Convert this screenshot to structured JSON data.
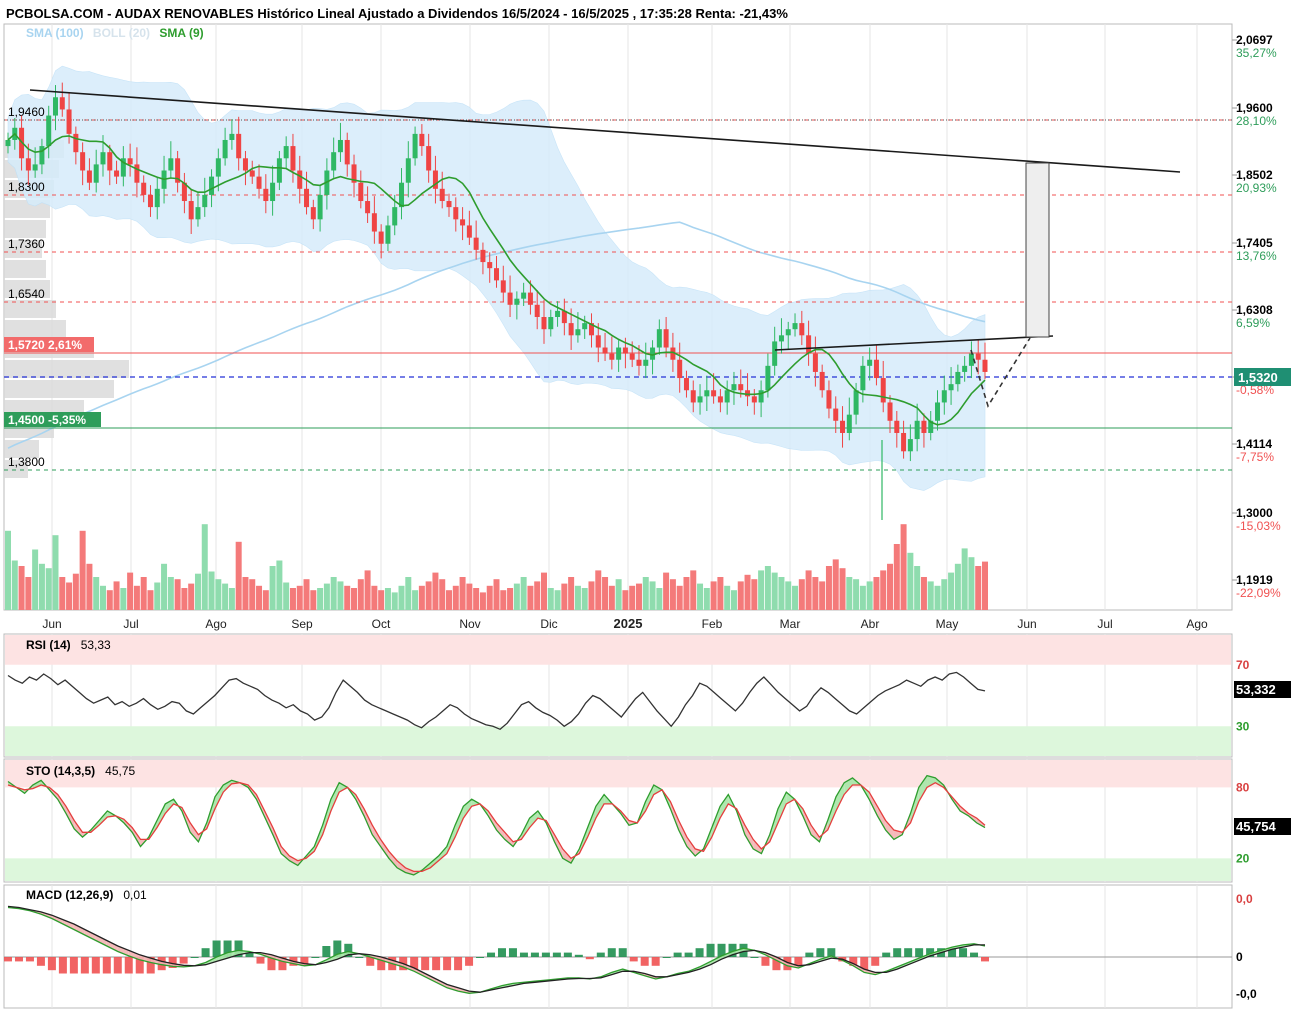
{
  "header": {
    "title": "PCBOLSA.COM - AUDAX RENOVABLES Histórico Lineal Ajustado a Dividendos 16/5/2024 - 16/5/2025 , 17:35:28 Renta: -21,43%"
  },
  "legend": {
    "sma100": {
      "label": "SMA (100)",
      "color": "#a8d4f0"
    },
    "boll": {
      "label": "BOLL (20)",
      "color": "#cfe3f3"
    },
    "sma9": {
      "label": "SMA (9)",
      "color": "#2e9d2e"
    }
  },
  "colors": {
    "up": "#4fc17b",
    "down": "#f05252",
    "sma9": "#2e9d2e",
    "sma100": "#a8d4f0",
    "boll_fill": "#d6ecfb",
    "trend": "#1a1a1a",
    "red_line": "#f05252",
    "green_line": "#2e9d5a",
    "blue_dash": "#2431d6"
  },
  "chart_data": [
    {
      "type": "candlestick",
      "name": "price",
      "x_labels": [
        "Jun",
        "Jul",
        "Ago",
        "Sep",
        "Oct",
        "Nov",
        "Dic",
        "2025",
        "Feb",
        "Mar",
        "Abr",
        "May",
        "Jun",
        "Jul",
        "Ago"
      ],
      "y_ticks_right": [
        {
          "value": "2,0697",
          "pct": "35,27%",
          "pct_color": "#2e9d5a"
        },
        {
          "value": "1,9600",
          "pct": "28,10%",
          "pct_color": "#2e9d5a"
        },
        {
          "value": "1,8502",
          "pct": "20,93%",
          "pct_color": "#2e9d5a"
        },
        {
          "value": "1,7405",
          "pct": "13,76%",
          "pct_color": "#2e9d5a"
        },
        {
          "value": "1,6308",
          "pct": "6,59%",
          "pct_color": "#2e9d5a"
        },
        {
          "value": "1,5320",
          "pct": "-0,58%",
          "pct_color": "#f05252"
        },
        {
          "value": "1,4114",
          "pct": "-7,75%",
          "pct_color": "#f05252"
        },
        {
          "value": "1,3000",
          "pct": "-15,03%",
          "pct_color": "#f05252"
        },
        {
          "value": "1,1919",
          "pct": "-22,09%",
          "pct_color": "#f05252"
        }
      ],
      "left_levels": [
        {
          "value": "1,9460",
          "kind": "red-dash"
        },
        {
          "value": "1,8300",
          "kind": "red-dash"
        },
        {
          "value": "1,7360",
          "kind": "red-dash"
        },
        {
          "value": "1,6540",
          "kind": "red-dash"
        },
        {
          "value": "1,5720 2,61%",
          "kind": "red-solid"
        },
        {
          "value": "1,4500 -5,35%",
          "kind": "green-solid"
        },
        {
          "value": "1,3800",
          "kind": "green-dash"
        }
      ],
      "last_price": "1,5320",
      "ylim": [
        1.14,
        2.1
      ],
      "closes": [
        1.91,
        1.93,
        1.88,
        1.86,
        1.87,
        1.9,
        1.95,
        1.98,
        1.96,
        1.92,
        1.89,
        1.86,
        1.84,
        1.87,
        1.89,
        1.86,
        1.85,
        1.88,
        1.87,
        1.84,
        1.82,
        1.8,
        1.83,
        1.86,
        1.88,
        1.84,
        1.81,
        1.78,
        1.8,
        1.82,
        1.85,
        1.88,
        1.91,
        1.92,
        1.88,
        1.86,
        1.85,
        1.83,
        1.81,
        1.84,
        1.88,
        1.9,
        1.86,
        1.83,
        1.8,
        1.78,
        1.82,
        1.86,
        1.89,
        1.91,
        1.87,
        1.84,
        1.81,
        1.79,
        1.76,
        1.74,
        1.77,
        1.8,
        1.84,
        1.88,
        1.92,
        1.9,
        1.86,
        1.83,
        1.81,
        1.8,
        1.78,
        1.77,
        1.75,
        1.73,
        1.71,
        1.7,
        1.68,
        1.66,
        1.64,
        1.65,
        1.66,
        1.64,
        1.62,
        1.6,
        1.62,
        1.63,
        1.61,
        1.59,
        1.6,
        1.61,
        1.59,
        1.57,
        1.56,
        1.55,
        1.57,
        1.56,
        1.55,
        1.54,
        1.55,
        1.57,
        1.6,
        1.57,
        1.55,
        1.52,
        1.5,
        1.48,
        1.49,
        1.5,
        1.49,
        1.48,
        1.5,
        1.51,
        1.5,
        1.49,
        1.48,
        1.5,
        1.54,
        1.58,
        1.59,
        1.6,
        1.61,
        1.59,
        1.56,
        1.53,
        1.5,
        1.47,
        1.45,
        1.43,
        1.46,
        1.5,
        1.54,
        1.55,
        1.52,
        1.48,
        1.45,
        1.43,
        1.4,
        1.42,
        1.45,
        1.43,
        1.45,
        1.48,
        1.5,
        1.51,
        1.53,
        1.54,
        1.56,
        1.55,
        1.53
      ],
      "volumes": [
        0.72,
        0.45,
        0.4,
        0.3,
        0.55,
        0.42,
        0.38,
        0.68,
        0.3,
        0.25,
        0.33,
        0.72,
        0.42,
        0.3,
        0.22,
        0.18,
        0.26,
        0.2,
        0.34,
        0.22,
        0.3,
        0.18,
        0.25,
        0.42,
        0.3,
        0.28,
        0.2,
        0.24,
        0.33,
        0.78,
        0.35,
        0.28,
        0.24,
        0.2,
        0.62,
        0.3,
        0.28,
        0.22,
        0.18,
        0.4,
        0.45,
        0.25,
        0.2,
        0.22,
        0.28,
        0.18,
        0.2,
        0.24,
        0.3,
        0.26,
        0.22,
        0.2,
        0.28,
        0.36,
        0.22,
        0.18,
        0.2,
        0.16,
        0.22,
        0.3,
        0.18,
        0.22,
        0.26,
        0.34,
        0.28,
        0.18,
        0.22,
        0.3,
        0.24,
        0.2,
        0.16,
        0.22,
        0.28,
        0.18,
        0.2,
        0.24,
        0.3,
        0.22,
        0.26,
        0.34,
        0.2,
        0.18,
        0.24,
        0.3,
        0.22,
        0.2,
        0.26,
        0.36,
        0.3,
        0.22,
        0.28,
        0.18,
        0.22,
        0.24,
        0.3,
        0.26,
        0.2,
        0.34,
        0.28,
        0.22,
        0.3,
        0.36,
        0.24,
        0.2,
        0.26,
        0.3,
        0.22,
        0.18,
        0.26,
        0.32,
        0.28,
        0.36,
        0.4,
        0.34,
        0.3,
        0.26,
        0.22,
        0.28,
        0.36,
        0.3,
        0.26,
        0.4,
        0.46,
        0.38,
        0.3,
        0.28,
        0.22,
        0.26,
        0.3,
        0.36,
        0.42,
        0.6,
        0.78,
        0.52,
        0.4,
        0.3,
        0.26,
        0.22,
        0.28,
        0.34,
        0.42,
        0.56,
        0.48,
        0.4,
        0.44
      ],
      "trendlines": {
        "upper": [
          [
            0.0,
            1.98
          ],
          [
            1.0,
            1.856
          ]
        ],
        "lower": [
          [
            0.62,
            1.5775
          ],
          [
            0.83,
            1.597
          ]
        ],
        "sma100_start": 1.4
      }
    },
    {
      "type": "line",
      "name": "RSI (14)",
      "label": "RSI (14)",
      "value_text": "53,33",
      "last_value": "53,332",
      "ticks": [
        "70",
        "30"
      ],
      "ylim": [
        0,
        100
      ],
      "values": [
        63,
        60,
        58,
        62,
        60,
        64,
        61,
        57,
        60,
        56,
        52,
        48,
        45,
        47,
        49,
        44,
        46,
        43,
        45,
        48,
        44,
        41,
        43,
        46,
        45,
        40,
        38,
        42,
        46,
        50,
        55,
        60,
        61,
        58,
        56,
        54,
        50,
        47,
        45,
        42,
        44,
        40,
        38,
        34,
        36,
        42,
        52,
        60,
        56,
        52,
        47,
        44,
        42,
        40,
        38,
        36,
        34,
        31,
        29,
        33,
        36,
        40,
        44,
        42,
        38,
        35,
        33,
        31,
        30,
        28,
        32,
        38,
        44,
        46,
        42,
        39,
        37,
        34,
        30,
        33,
        38,
        45,
        50,
        48,
        44,
        40,
        36,
        42,
        48,
        52,
        46,
        40,
        35,
        30,
        36,
        44,
        50,
        58,
        56,
        52,
        48,
        44,
        40,
        45,
        52,
        58,
        62,
        57,
        52,
        48,
        44,
        40,
        43,
        50,
        55,
        52,
        48,
        44,
        40,
        38,
        42,
        46,
        50,
        53,
        55,
        57,
        60,
        58,
        56,
        60,
        62,
        60,
        64,
        65,
        62,
        58,
        54,
        53
      ],
      "bands": {
        "overbought": 70,
        "oversold": 30
      }
    },
    {
      "type": "line",
      "name": "STO (14,3,5)",
      "label": "STO (14,3,5)",
      "value_text": "45,75",
      "last_value": "45,754",
      "ticks": [
        "80",
        "20"
      ],
      "ylim": [
        0,
        100
      ],
      "k": [
        85,
        80,
        75,
        82,
        86,
        78,
        70,
        58,
        45,
        38,
        44,
        52,
        60,
        56,
        50,
        42,
        30,
        38,
        52,
        66,
        70,
        60,
        42,
        34,
        50,
        72,
        82,
        86,
        84,
        80,
        70,
        55,
        40,
        24,
        18,
        14,
        22,
        30,
        48,
        70,
        84,
        80,
        70,
        56,
        40,
        30,
        20,
        12,
        8,
        6,
        10,
        16,
        22,
        30,
        48,
        64,
        70,
        66,
        56,
        44,
        36,
        30,
        40,
        54,
        60,
        50,
        34,
        20,
        16,
        28,
        46,
        64,
        74,
        66,
        58,
        48,
        50,
        68,
        82,
        78,
        62,
        44,
        30,
        22,
        28,
        46,
        64,
        74,
        60,
        40,
        28,
        24,
        40,
        62,
        76,
        70,
        56,
        40,
        34,
        52,
        72,
        84,
        88,
        82,
        70,
        56,
        44,
        36,
        40,
        58,
        80,
        90,
        88,
        82,
        70,
        60,
        56,
        50,
        46
      ],
      "d": [
        82,
        80,
        78,
        79,
        82,
        80,
        74,
        64,
        52,
        42,
        42,
        48,
        55,
        56,
        53,
        46,
        36,
        36,
        46,
        58,
        66,
        63,
        50,
        40,
        45,
        62,
        76,
        83,
        84,
        82,
        74,
        60,
        46,
        30,
        22,
        18,
        20,
        26,
        40,
        60,
        76,
        80,
        74,
        62,
        48,
        36,
        26,
        18,
        12,
        9,
        9,
        12,
        18,
        24,
        38,
        54,
        64,
        66,
        60,
        50,
        42,
        34,
        36,
        46,
        54,
        52,
        40,
        28,
        20,
        24,
        38,
        54,
        66,
        66,
        60,
        52,
        50,
        60,
        74,
        78,
        68,
        52,
        38,
        28,
        26,
        38,
        54,
        66,
        62,
        48,
        36,
        28,
        34,
        50,
        66,
        70,
        62,
        48,
        38,
        44,
        60,
        74,
        82,
        82,
        76,
        64,
        52,
        44,
        42,
        50,
        68,
        80,
        84,
        80,
        72,
        64,
        58,
        54,
        48
      ]
    },
    {
      "type": "line",
      "name": "MACD (12,26,9)",
      "label": "MACD (12,26,9)",
      "value_text": "0,01",
      "ticks": [
        "0,0",
        "0",
        "-0,0"
      ],
      "ylim": [
        -1,
        1
      ],
      "macd": [
        0.9,
        0.88,
        0.84,
        0.78,
        0.7,
        0.6,
        0.5,
        0.4,
        0.3,
        0.2,
        0.1,
        0.02,
        -0.05,
        -0.1,
        -0.14,
        -0.17,
        -0.18,
        -0.16,
        -0.1,
        0.0,
        0.08,
        0.12,
        0.1,
        0.05,
        -0.02,
        -0.08,
        -0.12,
        -0.16,
        -0.14,
        -0.05,
        0.05,
        0.1,
        0.06,
        0.0,
        -0.06,
        -0.12,
        -0.18,
        -0.26,
        -0.36,
        -0.46,
        -0.56,
        -0.62,
        -0.66,
        -0.64,
        -0.58,
        -0.52,
        -0.48,
        -0.46,
        -0.44,
        -0.42,
        -0.4,
        -0.38,
        -0.38,
        -0.4,
        -0.36,
        -0.28,
        -0.22,
        -0.28,
        -0.34,
        -0.4,
        -0.36,
        -0.3,
        -0.26,
        -0.18,
        -0.08,
        0.02,
        0.1,
        0.16,
        0.12,
        0.04,
        -0.06,
        -0.16,
        -0.2,
        -0.12,
        -0.04,
        0.02,
        -0.06,
        -0.16,
        -0.28,
        -0.32,
        -0.26,
        -0.18,
        -0.1,
        -0.02,
        0.06,
        0.12,
        0.18,
        0.22,
        0.24,
        0.2
      ],
      "signal": [
        0.92,
        0.9,
        0.86,
        0.82,
        0.76,
        0.68,
        0.6,
        0.5,
        0.4,
        0.3,
        0.2,
        0.12,
        0.04,
        -0.02,
        -0.08,
        -0.12,
        -0.15,
        -0.16,
        -0.14,
        -0.08,
        -0.02,
        0.04,
        0.08,
        0.08,
        0.04,
        -0.02,
        -0.08,
        -0.12,
        -0.14,
        -0.1,
        -0.04,
        0.04,
        0.06,
        0.04,
        0.0,
        -0.06,
        -0.12,
        -0.2,
        -0.3,
        -0.4,
        -0.5,
        -0.56,
        -0.62,
        -0.64,
        -0.6,
        -0.56,
        -0.52,
        -0.48,
        -0.46,
        -0.44,
        -0.42,
        -0.4,
        -0.39,
        -0.39,
        -0.38,
        -0.32,
        -0.26,
        -0.26,
        -0.3,
        -0.36,
        -0.36,
        -0.32,
        -0.28,
        -0.22,
        -0.14,
        -0.04,
        0.04,
        0.1,
        0.12,
        0.08,
        0.0,
        -0.1,
        -0.16,
        -0.14,
        -0.08,
        -0.02,
        -0.04,
        -0.12,
        -0.22,
        -0.28,
        -0.28,
        -0.22,
        -0.14,
        -0.06,
        0.02,
        0.08,
        0.14,
        0.18,
        0.22,
        0.22
      ]
    }
  ]
}
